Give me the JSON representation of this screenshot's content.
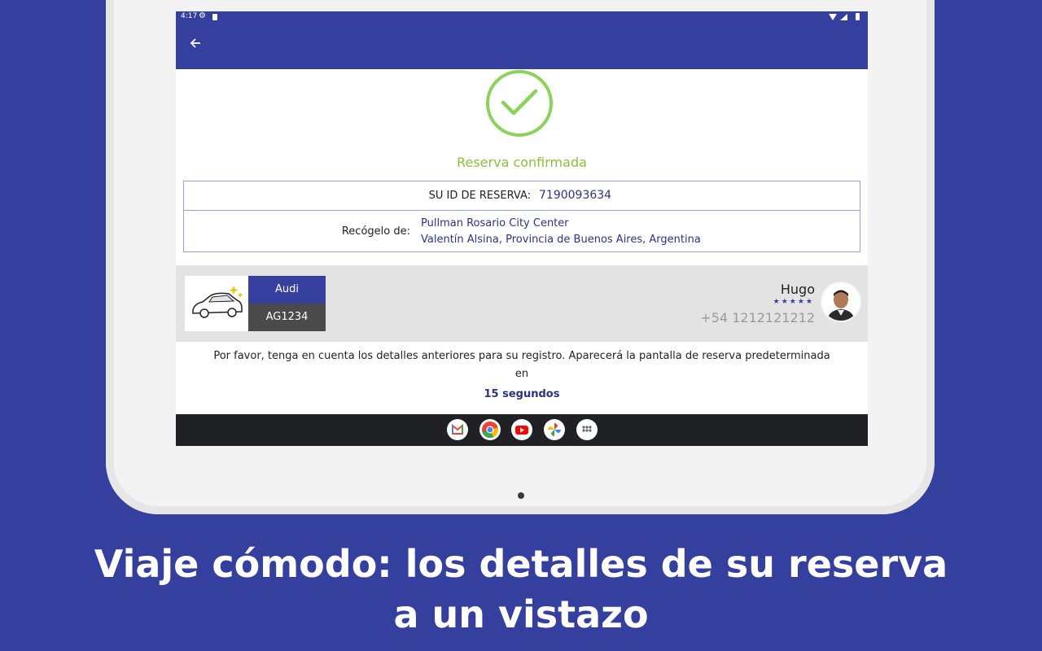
{
  "status_bar": {
    "time": "4:17"
  },
  "booking": {
    "title": "Reserva confirmada",
    "id_label": "SU ID DE RESERVA:",
    "id_value": "7190093634",
    "pickup_label": "Recógelo de:",
    "pickup_line1": "Pullman Rosario City Center",
    "pickup_line2": "Valentín Alsina, Provincia de Buenos Aires, Argentina"
  },
  "vehicle": {
    "brand": "Audi",
    "plate": "AG1234"
  },
  "driver": {
    "name": "Hugo",
    "stars": "★★★★★",
    "phone": "+54 1212121212"
  },
  "notice": {
    "line1": "Por favor, tenga en cuenta los detalles anteriores para su registro. Aparecerá la pantalla de reserva predeterminada",
    "line2": "en",
    "countdown": "15 segundos"
  },
  "dock": [
    "gmail-icon",
    "chrome-icon",
    "youtube-icon",
    "photos-icon",
    "apps-icon"
  ],
  "caption": {
    "line1": "Viaje cómodo: los detalles de su reserva",
    "line2": "a un vistazo"
  },
  "colors": {
    "brand": "#343f9e",
    "success": "#8bd15a",
    "success_text": "#8cbf3f",
    "background": "#343f9e"
  }
}
